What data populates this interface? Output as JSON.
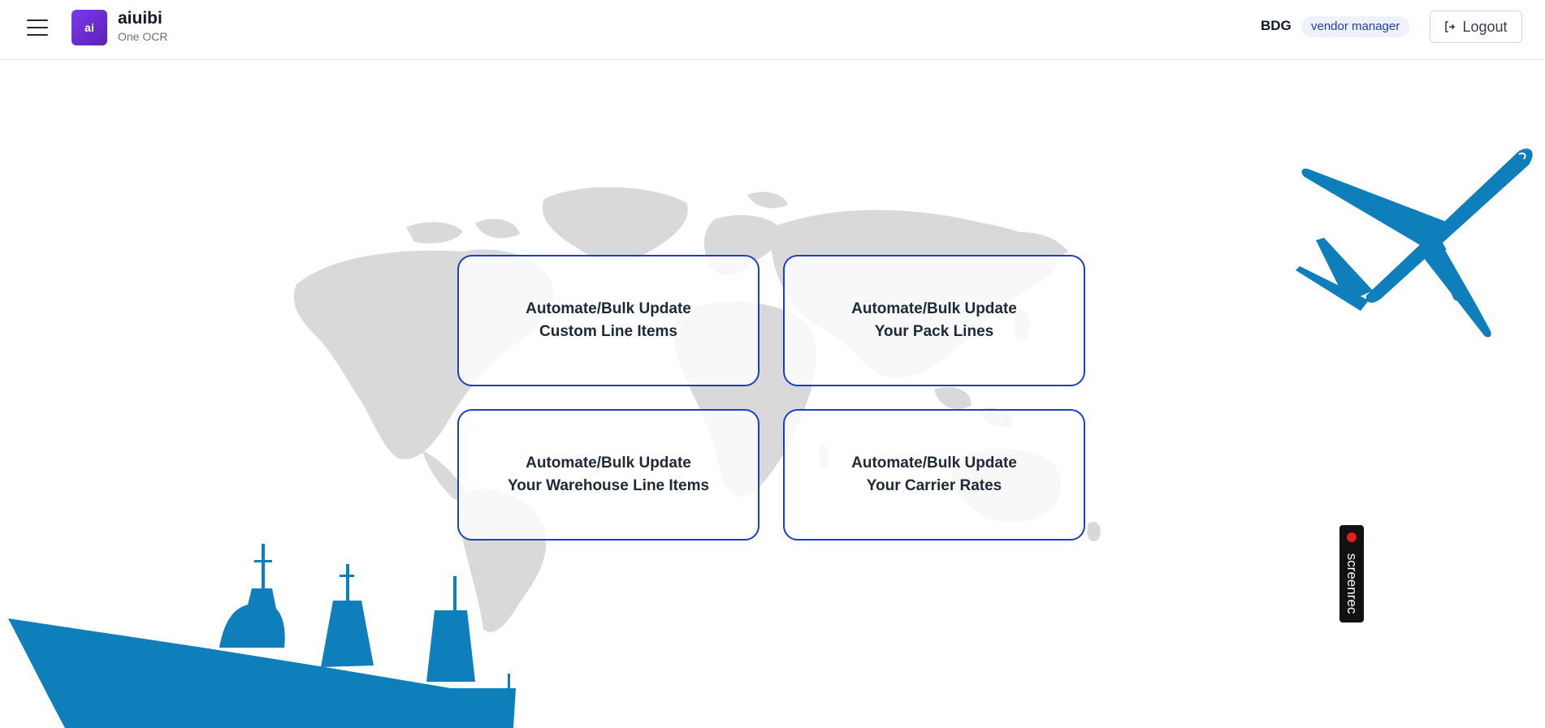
{
  "header": {
    "menu_icon": "hamburger-menu-icon",
    "logo_text": "ai",
    "brand_name": "aiuibi",
    "brand_subtitle": "One OCR",
    "org_code": "BDG",
    "role_badge": "vendor manager",
    "logout_label": "Logout",
    "logout_icon": "logout-icon"
  },
  "cards": [
    {
      "line1": "Automate/Bulk Update",
      "line2": "Custom Line Items"
    },
    {
      "line1": "Automate/Bulk Update",
      "line2": "Your Pack Lines"
    },
    {
      "line1": "Automate/Bulk Update",
      "line2": "Your Warehouse Line Items"
    },
    {
      "line1": "Automate/Bulk Update",
      "line2": "Your Carrier Rates"
    }
  ],
  "screenrec": {
    "label": "screenrec"
  },
  "colors": {
    "accent": "#1d3fc4",
    "logo_purple": "#6d28d9",
    "illustration_blue": "#0e7fbb",
    "map_gray": "#d9d9d9"
  }
}
